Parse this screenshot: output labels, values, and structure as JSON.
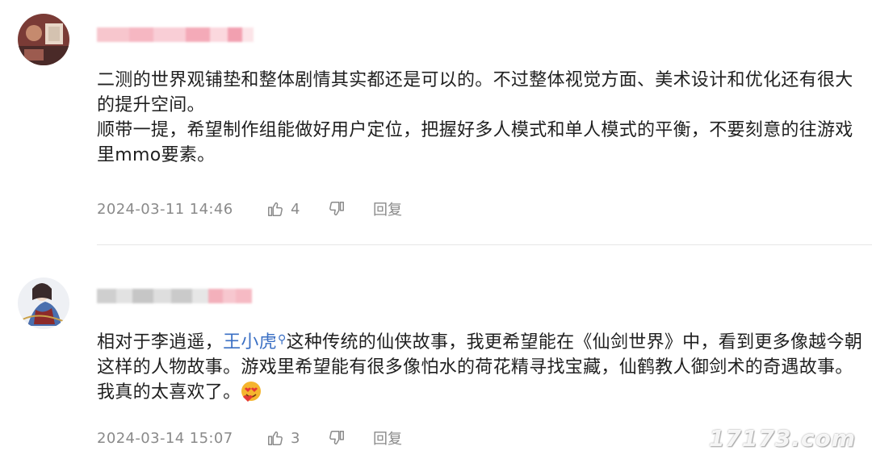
{
  "comments": [
    {
      "username_blurred": true,
      "paragraphs": [
        "二测的世界观铺垫和整体剧情其实都还是可以的。不过整体视觉方面、美术设计和优化还有很大的提升空间。",
        "顺带一提，希望制作组能做好用户定位，把握好多人模式和单人模式的平衡，不要刻意的往游戏里mmo要素。"
      ],
      "time": "2024-03-11 14:46",
      "likes": "4",
      "reply_label": "回复"
    },
    {
      "username_blurred": true,
      "text_before_mention": "相对于李逍遥，",
      "mention": "王小虎",
      "text_after_mention": "这种传统的仙侠故事，我更希望能在《仙剑世界》中，看到更多像越今朝这样的人物故事。游戏里希望能有很多像怕水的荷花精寻找宝藏，仙鹤教人御剑术的奇遇故事。我真的太喜欢了。",
      "emoji_icon": "heart-eyes-emoji",
      "time": "2024-03-14 15:07",
      "likes": "3",
      "reply_label": "回复"
    }
  ],
  "watermark": "17173.com",
  "colors": {
    "mention": "#3a6fc4",
    "meta_text": "#8a8a8a",
    "divider": "#e6e6e6"
  }
}
